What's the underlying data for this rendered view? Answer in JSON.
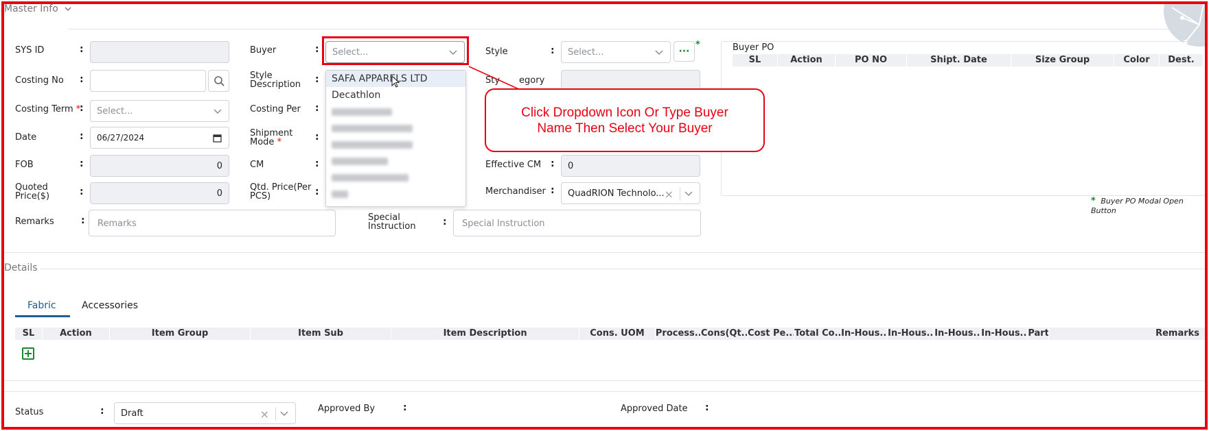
{
  "sections": {
    "master_info": "Master Info",
    "details": "Details"
  },
  "form": {
    "sys_id": {
      "label": "SYS ID",
      "value": ""
    },
    "costing_no": {
      "label": "Costing No",
      "value": ""
    },
    "costing_term": {
      "label": "Costing Term",
      "required": "*",
      "placeholder": "Select..."
    },
    "date": {
      "label": "Date",
      "value": "06/27/2024"
    },
    "fob": {
      "label": "FOB",
      "value": "0"
    },
    "quoted_price": {
      "label_line1": "Quoted",
      "label_line2": "Price($)",
      "value": "0"
    },
    "remarks": {
      "label": "Remarks",
      "placeholder": "Remarks"
    },
    "buyer": {
      "label": "Buyer",
      "placeholder": "Select..."
    },
    "style_description": {
      "label_line1": "Style",
      "label_line2": "Description"
    },
    "costing_per": {
      "label": "Costing Per"
    },
    "shipment_mode": {
      "label_line1": "Shipment",
      "label_line2": "Mode",
      "required": "*"
    },
    "cm": {
      "label": "CM"
    },
    "qtd_price": {
      "label_line1": "Qtd. Price(Per",
      "label_line2": "PCS)"
    },
    "special_instruction": {
      "label_line1": "Special",
      "label_line2": "Instruction",
      "placeholder": "Special Instruction"
    },
    "style": {
      "label": "Style",
      "placeholder": "Select...",
      "more_mark": "*"
    },
    "style_category": {
      "label_visible": "Sty",
      "label_tail": "egory"
    },
    "effective_cm": {
      "label": "Effective CM",
      "value": "0"
    },
    "merchandiser": {
      "label": "Merchandiser",
      "value": "QuadRION Technolo..."
    }
  },
  "buyer_dropdown": {
    "options": [
      "SAFA APPARELS LTD",
      "Decathlon"
    ],
    "blurred_count": 6
  },
  "callout": {
    "line1": "Click Dropdown Icon Or Type Buyer",
    "line2": "Name Then Select Your Buyer"
  },
  "buyer_po": {
    "title": "Buyer PO",
    "columns": [
      "SL",
      "Action",
      "PO NO",
      "Shipt. Date",
      "Size Group",
      "Color",
      "Dest."
    ],
    "legend_mark": "*",
    "legend_text": "Buyer PO Modal Open Button"
  },
  "details": {
    "tabs": [
      "Fabric",
      "Accessories"
    ],
    "columns": [
      "SL",
      "Action",
      "Item Group",
      "Item Sub",
      "Item Description",
      "Cons. UOM",
      "Process...",
      "Cons(Qt...",
      "Cost Pe...",
      "Total Co...",
      "In-Hous...",
      "In-Hous...",
      "In-Hous...",
      "In-Hous...",
      "Part",
      "Remarks"
    ]
  },
  "footer": {
    "status_label": "Status",
    "status_value": "Draft",
    "approved_by_label": "Approved By",
    "approved_date_label": "Approved Date"
  },
  "colors": {
    "annotation": "#e60012",
    "tab_active": "#1f5c8f",
    "disabled_bg": "#eef0f3",
    "green_icon": "#1a8a2e"
  }
}
